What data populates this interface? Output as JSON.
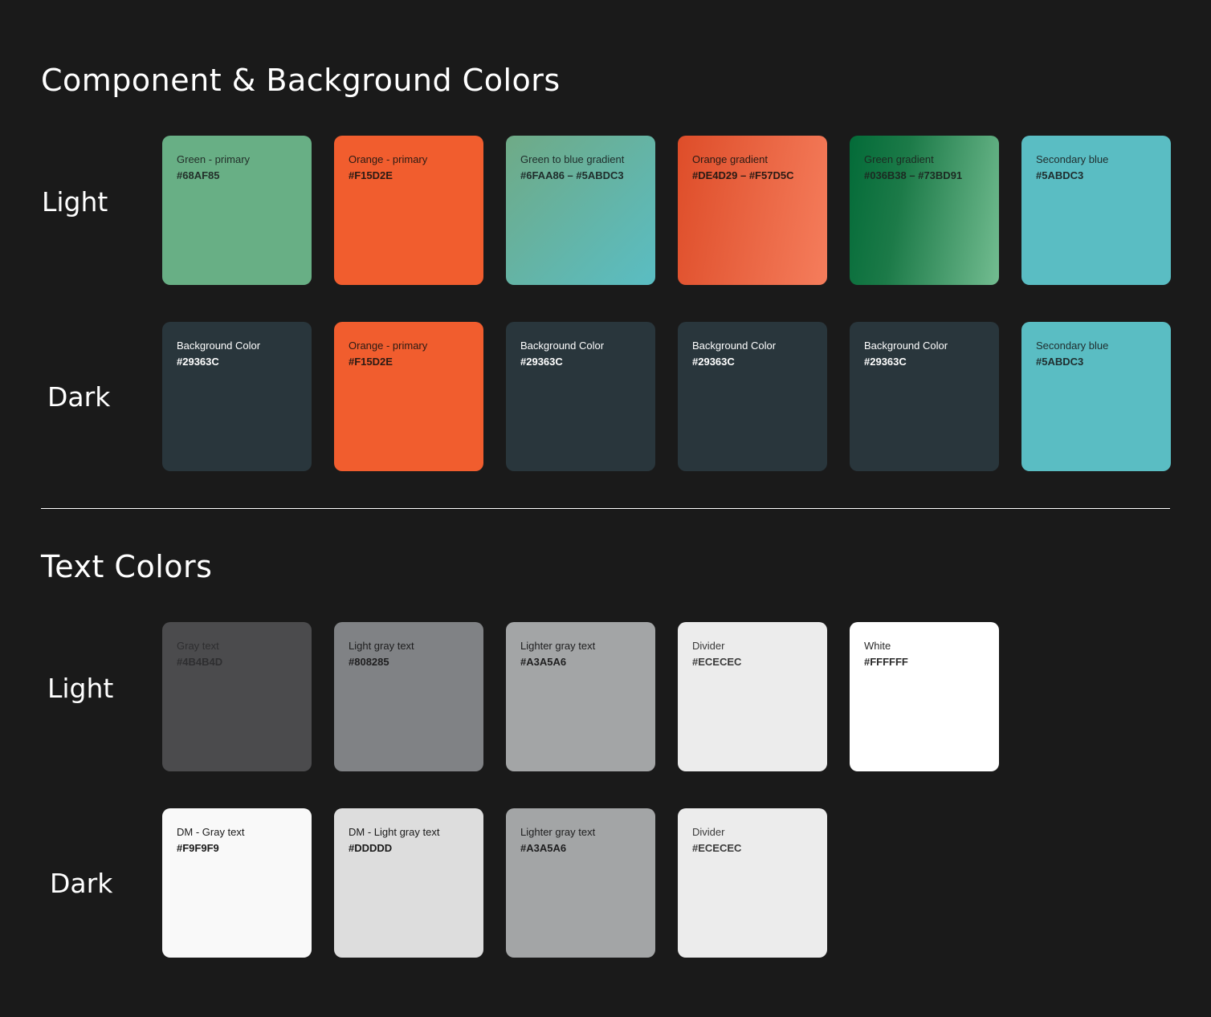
{
  "component_section": {
    "title": "Component & Background Colors",
    "light_label": "Light",
    "dark_label": "Dark",
    "light": [
      {
        "name": "Green - primary",
        "hex": "#68AF85",
        "fill": "#68AF85",
        "text_color": "#23302a"
      },
      {
        "name": "Orange - primary",
        "hex": "#F15D2E",
        "fill": "#F15D2E",
        "text_color": "#2a1a14"
      },
      {
        "name": "Green to blue gradient",
        "hex": "#6FAA86 – #5ABDC3",
        "fill": "linear-gradient(135deg, #6FAA86 0%, #5ABDC3 100%)",
        "text_color": "#1f2d2b"
      },
      {
        "name": "Orange gradient",
        "hex": "#DE4D29 – #F57D5C",
        "fill": "linear-gradient(100deg, #DE4D29 0%, #F57D5C 100%)",
        "text_color": "#2a1a14"
      },
      {
        "name": "Green gradient",
        "hex": "#036B38 – #73BD91",
        "fill": "linear-gradient(100deg, #036B38 0%, #1c7a48 35%, #73BD91 100%)",
        "text_color": "#1c2a22"
      },
      {
        "name": "Secondary blue",
        "hex": "#5ABDC3",
        "fill": "#5ABDC3",
        "text_color": "#1f2d2e"
      }
    ],
    "dark": [
      {
        "name": "Background Color",
        "hex": "#29363C",
        "fill": "#29363C",
        "text_color": "#ffffff"
      },
      {
        "name": "Orange - primary",
        "hex": "#F15D2E",
        "fill": "#F15D2E",
        "text_color": "#2a1a14"
      },
      {
        "name": "Background Color",
        "hex": "#29363C",
        "fill": "#29363C",
        "text_color": "#ffffff"
      },
      {
        "name": "Background Color",
        "hex": "#29363C",
        "fill": "#29363C",
        "text_color": "#ffffff"
      },
      {
        "name": "Background Color",
        "hex": "#29363C",
        "fill": "#29363C",
        "text_color": "#ffffff"
      },
      {
        "name": "Secondary blue",
        "hex": "#5ABDC3",
        "fill": "#5ABDC3",
        "text_color": "#1f2d2e"
      }
    ]
  },
  "text_section": {
    "title": "Text Colors",
    "light_label": "Light",
    "dark_label": "Dark",
    "light": [
      {
        "name": "Gray text",
        "hex": "#4B4B4D",
        "fill": "#4B4B4D",
        "text_color": "#2e2e30"
      },
      {
        "name": "Light gray text",
        "hex": "#808285",
        "fill": "#808285",
        "text_color": "#1e1e1f"
      },
      {
        "name": "Lighter gray text",
        "hex": "#A3A5A6",
        "fill": "#A3A5A6",
        "text_color": "#1e1e1f"
      },
      {
        "name": "Divider",
        "hex": "#ECECEC",
        "fill": "#ECECEC",
        "text_color": "#3a3a3a"
      },
      {
        "name": "White",
        "hex": "#FFFFFF",
        "fill": "#FFFFFF",
        "text_color": "#2a2a2a"
      }
    ],
    "dark": [
      {
        "name": "DM - Gray text",
        "hex": "#F9F9F9",
        "fill": "#F9F9F9",
        "text_color": "#1a1a1a"
      },
      {
        "name": "DM - Light gray text",
        "hex": "#DDDDD",
        "fill": "#DDDDDD",
        "text_color": "#1a1a1a"
      },
      {
        "name": "Lighter gray text",
        "hex": "#A3A5A6",
        "fill": "#A3A5A6",
        "text_color": "#1e1e1f"
      },
      {
        "name": "Divider",
        "hex": "#ECECEC",
        "fill": "#ECECEC",
        "text_color": "#3a3a3a"
      }
    ]
  }
}
